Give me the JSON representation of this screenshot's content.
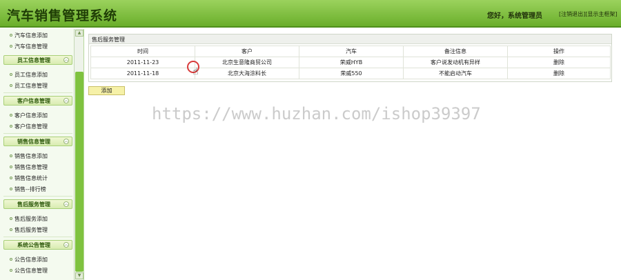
{
  "header": {
    "title": "汽车销售管理系统",
    "greeting": "您好，系统管理员",
    "logout_link": "[注销退出]",
    "show_frame_link": "[显示主框架]",
    "colors": {
      "bar_light": "#9bd25d",
      "bar_dark": "#6aae2b"
    }
  },
  "sidebar": {
    "top_items": [
      "汽车信息添加",
      "汽车信息管理"
    ],
    "groups": [
      {
        "title": "员工信息管理",
        "items": [
          "员工信息添加",
          "员工信息管理"
        ]
      },
      {
        "title": "客户信息管理",
        "items": [
          "客户信息添加",
          "客户信息管理"
        ]
      },
      {
        "title": "销售信息管理",
        "items": [
          "销售信息添加",
          "销售信息管理",
          "销售信息统计",
          "销售--排行榜"
        ]
      },
      {
        "title": "售后服务管理",
        "items": [
          "售后服务添加",
          "售后服务管理"
        ]
      },
      {
        "title": "系统公告管理",
        "items": [
          "公告信息添加",
          "公告信息管理"
        ]
      }
    ],
    "collapse_icon": "double-chevron-up-icon"
  },
  "main": {
    "panel_title": "售后服务管理",
    "columns": [
      "时间",
      "客户",
      "汽车",
      "备注信息",
      "操作"
    ],
    "rows": [
      {
        "time": "2011-11-23",
        "customer": "北京生意隆商贸公司",
        "car": "荣威HYB",
        "note": "客户说发动机有异样",
        "action": "删除"
      },
      {
        "time": "2011-11-18",
        "customer": "北京大海涂料长",
        "car": "荣威550",
        "note": "不能启动汽车",
        "action": "删除"
      }
    ],
    "add_button": "添加"
  },
  "watermark": "https://www.huzhan.com/ishop39397"
}
